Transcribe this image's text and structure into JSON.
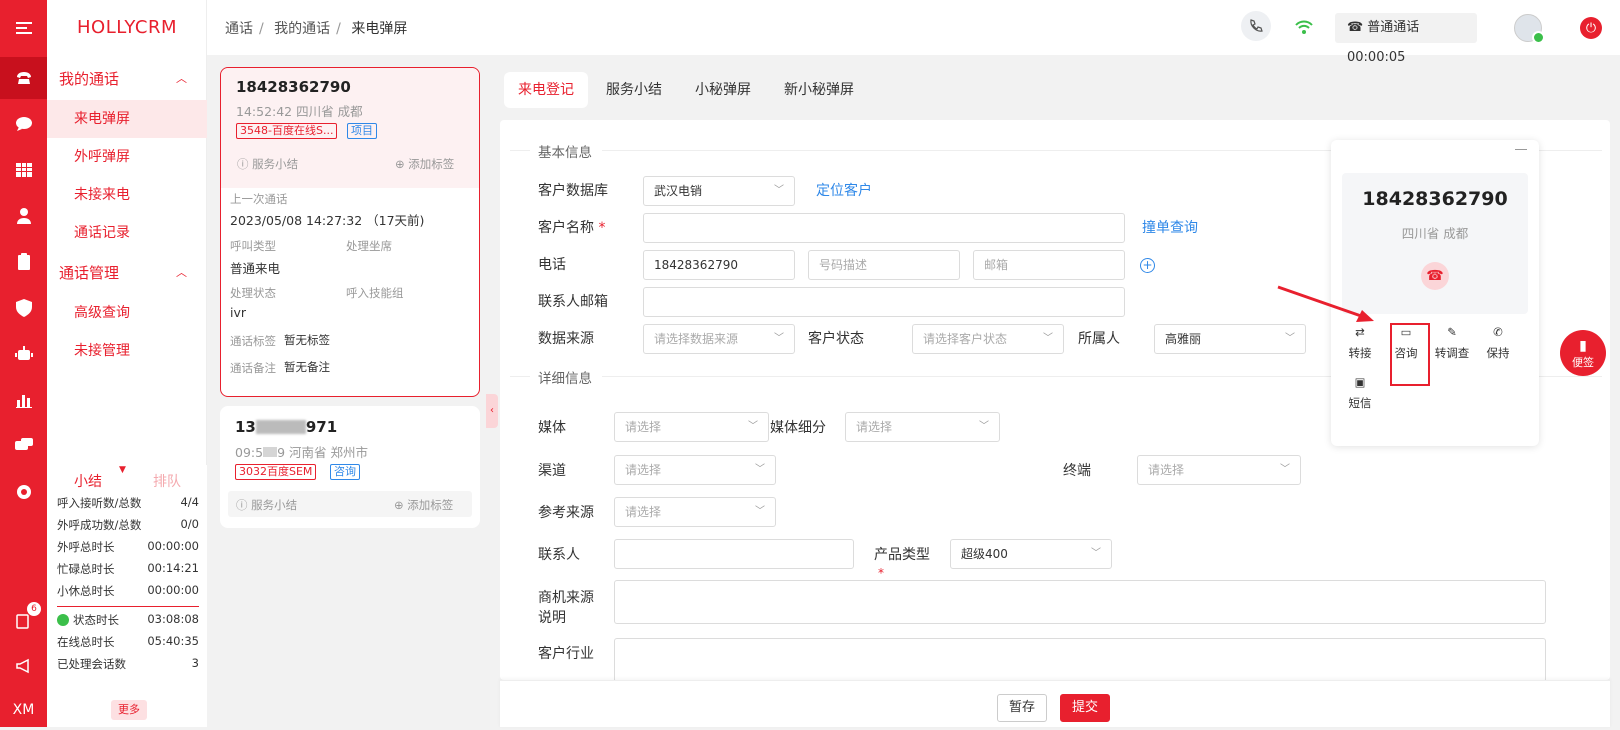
{
  "app": {
    "logo": "HOLLYCRM",
    "footer_label": "XM",
    "notification_count": "6"
  },
  "menu": {
    "group1": "我的通话",
    "items1": [
      "来电弹屏",
      "外呼弹屏",
      "未接来电",
      "通话记录"
    ],
    "group2": "通话管理",
    "items2": [
      "高级查询",
      "未接管理"
    ]
  },
  "stats": {
    "tab_summary": "小结",
    "tab_queue": "排队",
    "rows": [
      {
        "label": "呼入接听数/总数",
        "value": "4/4"
      },
      {
        "label": "外呼成功数/总数",
        "value": "0/0"
      },
      {
        "label": "外呼总时长",
        "value": "00:00:00"
      },
      {
        "label": "忙碌总时长",
        "value": "00:14:21"
      },
      {
        "label": "小休总时长",
        "value": "00:00:00"
      }
    ],
    "rows2": [
      {
        "label": "状态时长",
        "value": "03:08:08"
      },
      {
        "label": "在线总时长",
        "value": "05:40:35"
      },
      {
        "label": "已处理会话数",
        "value": "3"
      }
    ],
    "more": "更多"
  },
  "header": {
    "breadcrumb": [
      "通话",
      "我的通话",
      "来电弹屏"
    ],
    "call_status": "普通通话 00:00:05"
  },
  "calls": [
    {
      "number": "18428362790",
      "time_location": "14:52:42 四川省 成都",
      "tag1": "3548-百度在线S...",
      "tag2": "项目",
      "summary": "服务小结",
      "add_tag": "添加标签",
      "last_call_label": "上一次通话",
      "last_call_value": "2023/05/08 14:27:32 （17天前)",
      "call_type_label": "呼叫类型",
      "call_type_value": "普通来电",
      "seat_label": "处理坐席",
      "status_label": "处理状态",
      "status_value": "ivr",
      "skill_label": "呼入技能组",
      "tags_label": "通话标签",
      "tags_value": "暂无标签",
      "remark_label": "通话备注",
      "remark_value": "暂无备注"
    },
    {
      "number_start": "13",
      "number_end": "971",
      "time_start": "09:5",
      "time_location": "9 河南省 郑州市",
      "tag1": "3032百度SEM",
      "tag2": "咨询",
      "summary": "服务小结",
      "add_tag": "添加标签"
    }
  ],
  "tabs": [
    "来电登记",
    "服务小结",
    "小秘弹屏",
    "新小秘弹屏"
  ],
  "form": {
    "basic_section": "基本信息",
    "detail_section": "详细信息",
    "customer_db_label": "客户数据库",
    "customer_db_value": "武汉电销",
    "locate_customer": "定位客户",
    "customer_name_label": "客户名称",
    "dup_query": "撞单查询",
    "phone_label": "电话",
    "phone_value": "18428362790",
    "phone_desc_ph": "号码描述",
    "email_ph": "邮箱",
    "contact_email_label": "联系人邮箱",
    "data_source_label": "数据来源",
    "data_source_ph": "请选择数据来源",
    "customer_status_label": "客户状态",
    "customer_status_ph": "请选择客户状态",
    "owner_label": "所属人",
    "owner_value": "高雅丽",
    "media_label": "媒体",
    "media_sub_label": "媒体细分",
    "channel_label": "渠道",
    "terminal_label": "终端",
    "ref_source_label": "参考来源",
    "select_ph": "请选择",
    "contact_label": "联系人",
    "product_type_label": "产品类型",
    "product_type_value": "超级400",
    "biz_source_label_1": "商机来源",
    "biz_source_label_2": "说明",
    "industry_label": "客户行业"
  },
  "float_panel": {
    "number": "18428362790",
    "location": "四川省 成都",
    "actions": [
      "转接",
      "咨询",
      "转调查",
      "保持",
      "短信"
    ]
  },
  "notes_button": "便签",
  "bottom": {
    "save": "暂存",
    "submit": "提交"
  },
  "colors": {
    "brand": "#e8202e",
    "link": "#2f88e8"
  }
}
